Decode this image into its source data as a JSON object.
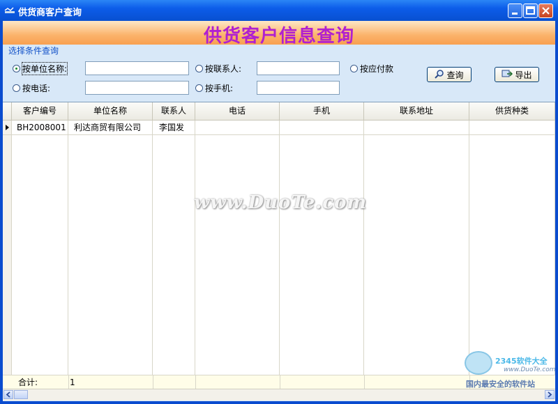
{
  "window": {
    "title": "供货商客户查询"
  },
  "banner": {
    "title": "供货客户信息查询"
  },
  "query": {
    "group_label": "选择条件查询",
    "radios": [
      {
        "label": "按单位名称:",
        "checked": true
      },
      {
        "label": "按联系人:",
        "checked": false
      },
      {
        "label": "按应付款",
        "checked": false
      },
      {
        "label": "按电话:",
        "checked": false
      },
      {
        "label": "按手机:",
        "checked": false
      }
    ],
    "inputs": {
      "unit_name": "",
      "contact": "",
      "phone": "",
      "mobile": ""
    },
    "buttons": {
      "search": "查询",
      "export": "导出"
    }
  },
  "grid": {
    "columns": [
      "客户编号",
      "单位名称",
      "联系人",
      "电话",
      "手机",
      "联系地址",
      "供货种类"
    ],
    "rows": [
      [
        "BH2008001",
        "利达商贸有限公司",
        "李国发",
        "",
        "",
        "",
        ""
      ]
    ],
    "footer": {
      "label": "合计:",
      "count": "1"
    }
  },
  "watermarks": {
    "center": "www.DuoTe.com",
    "logo_line1": "2345软件大全",
    "logo_line2": "www.DuoTe.com",
    "logo_line3": "国内最安全的软件站"
  },
  "colors": {
    "title_bar": "#0c5ce9",
    "banner_text": "#b020d0",
    "banner_bg": "#fbb36b",
    "panel_bg": "#d8e8f8"
  },
  "icons": {
    "search": "magnifier-icon",
    "export": "export-icon"
  }
}
